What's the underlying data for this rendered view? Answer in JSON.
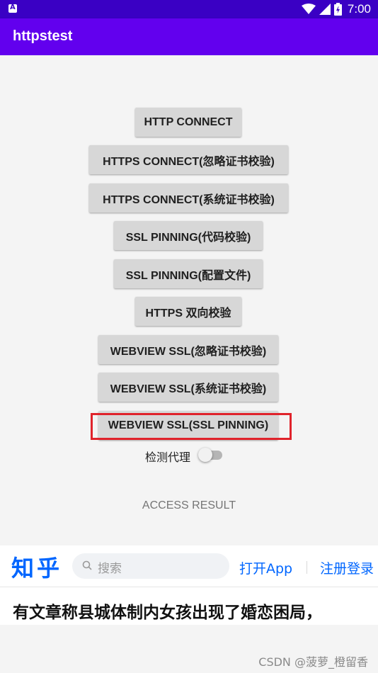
{
  "status_bar": {
    "time": "7:00",
    "icons": [
      "app-notification-icon",
      "wifi-icon",
      "signal-icon",
      "battery-icon"
    ]
  },
  "app_bar": {
    "title": "httpstest",
    "color": "#6200ee"
  },
  "buttons": [
    {
      "label": "HTTP CONNECT"
    },
    {
      "label": "HTTPS CONNECT(忽略证书校验)"
    },
    {
      "label": "HTTPS CONNECT(系统证书校验)"
    },
    {
      "label": "SSL PINNING(代码校验)"
    },
    {
      "label": "SSL PINNING(配置文件)"
    },
    {
      "label": "HTTPS 双向校验"
    },
    {
      "label": "WEBVIEW SSL(忽略证书校验)"
    },
    {
      "label": "WEBVIEW SSL(系统证书校验)"
    },
    {
      "label": "WEBVIEW SSL(SSL PINNING)"
    }
  ],
  "proxy_toggle": {
    "label": "检测代理",
    "state": "off"
  },
  "result_label": "ACCESS RESULT",
  "zhihu_banner": {
    "logo": "知乎",
    "search_placeholder": "搜索",
    "open_app": "打开App",
    "login": "注册登录",
    "headline": "有文章称县城体制内女孩出现了婚恋困局，",
    "brand_color": "#0066ff"
  },
  "watermark": "CSDN @菠萝_橙留香",
  "highlight_color": "#e0232b"
}
